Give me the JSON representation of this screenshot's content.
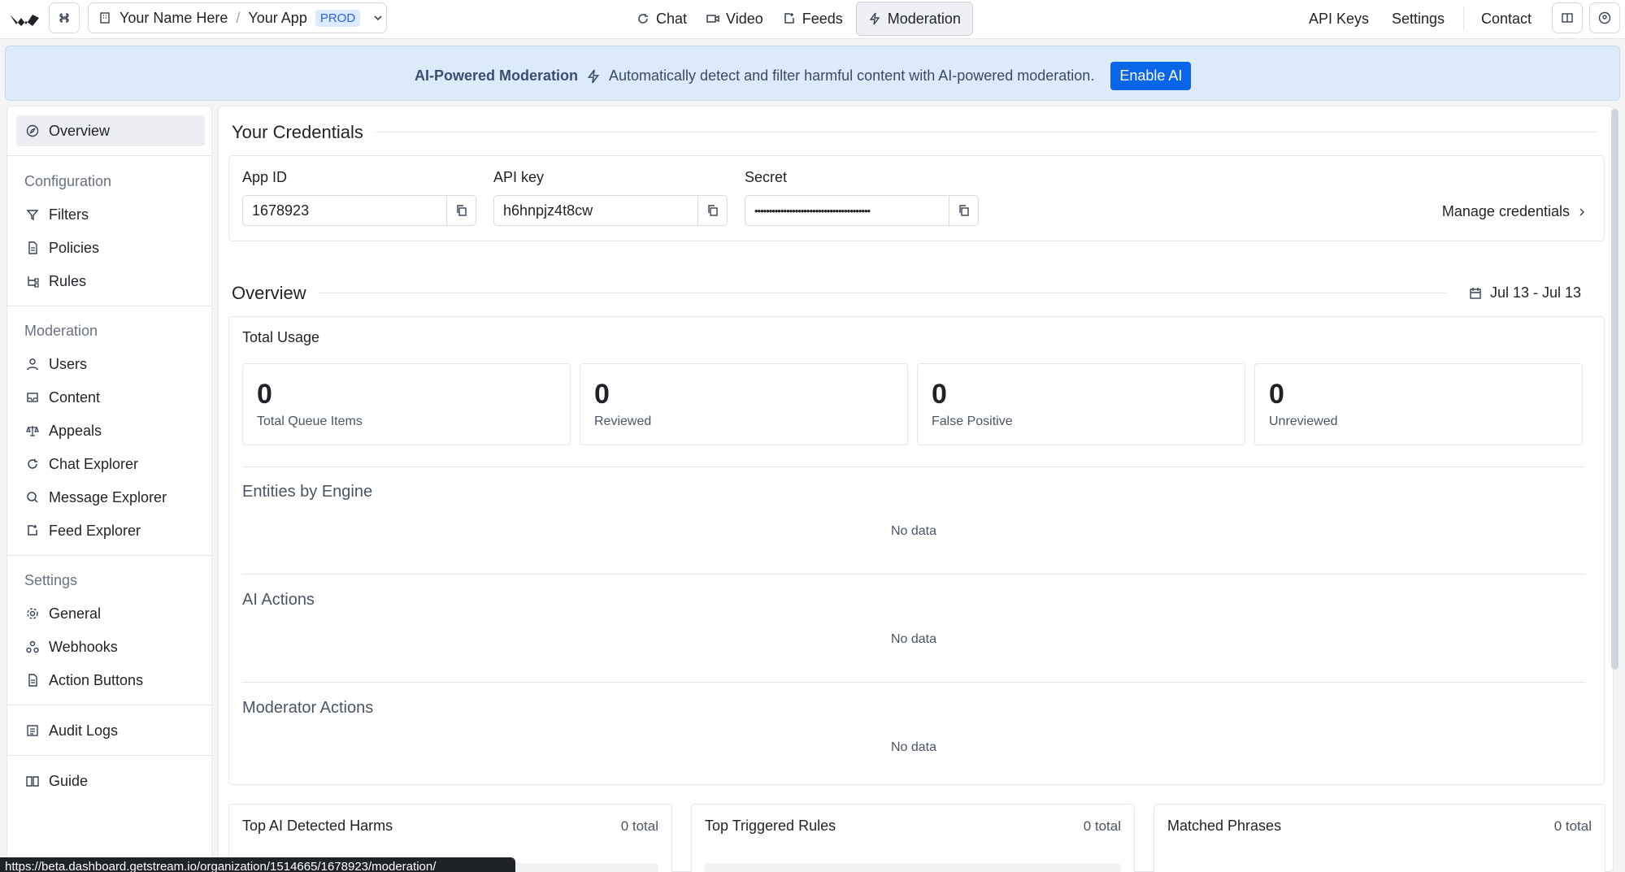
{
  "header": {
    "org": "Your Name Here",
    "app": "Your App",
    "env": "PROD",
    "nav": [
      {
        "label": "Chat",
        "icon": "chat-icon"
      },
      {
        "label": "Video",
        "icon": "video-icon"
      },
      {
        "label": "Feeds",
        "icon": "feeds-icon"
      },
      {
        "label": "Moderation",
        "icon": "bolt-icon",
        "active": true
      }
    ],
    "links": [
      "API Keys",
      "Settings",
      "Contact"
    ]
  },
  "banner": {
    "title": "AI-Powered Moderation",
    "text": "Automatically detect and filter harmful content with AI-powered moderation.",
    "button": "Enable AI"
  },
  "sidebar": {
    "overview": "Overview",
    "config_heading": "Configuration",
    "config_items": [
      "Filters",
      "Policies",
      "Rules"
    ],
    "moderation_heading": "Moderation",
    "moderation_items": [
      "Users",
      "Content",
      "Appeals",
      "Chat Explorer",
      "Message Explorer",
      "Feed Explorer"
    ],
    "settings_heading": "Settings",
    "settings_items": [
      "General",
      "Webhooks",
      "Action Buttons"
    ],
    "audit": "Audit Logs",
    "guide": "Guide"
  },
  "credentials": {
    "title": "Your Credentials",
    "app_id_label": "App ID",
    "app_id": "1678923",
    "api_key_label": "API key",
    "api_key": "h6hnpjz4t8cw",
    "secret_label": "Secret",
    "secret": "••••••••••••••••••••••••••••••••••••••••",
    "manage": "Manage credentials"
  },
  "overview": {
    "title": "Overview",
    "date_range": "Jul 13 - Jul 13",
    "total_usage": "Total Usage",
    "stats": [
      {
        "value": "0",
        "label": "Total Queue Items"
      },
      {
        "value": "0",
        "label": "Reviewed"
      },
      {
        "value": "0",
        "label": "False Positive"
      },
      {
        "value": "0",
        "label": "Unreviewed"
      }
    ],
    "entities_title": "Entities by Engine",
    "ai_actions_title": "AI Actions",
    "moderator_actions_title": "Moderator Actions",
    "no_data": "No data"
  },
  "bottom": [
    {
      "title": "Top AI Detected Harms",
      "count": "0 total"
    },
    {
      "title": "Top Triggered Rules",
      "count": "0 total"
    },
    {
      "title": "Matched Phrases",
      "count": "0 total"
    }
  ],
  "status_url": "https://beta.dashboard.getstream.io/organization/1514665/1678923/moderation/"
}
